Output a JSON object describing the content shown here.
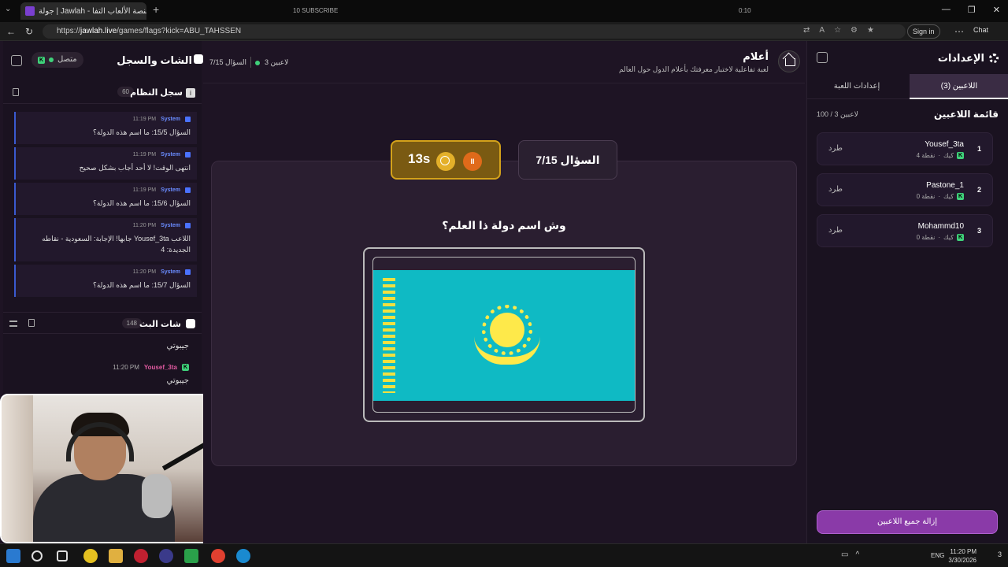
{
  "browser": {
    "tab_title": "جولة | Jawlah - منصة الألعاب التفا...",
    "url_prefix": "https://",
    "url_host": "jawlah.live",
    "url_path": "/games/flags?kick=ABU_TAHSSEN",
    "sign_in": "Sign in",
    "chat": "Chat",
    "overlay_subscribe": "10 SUBSCRIBE",
    "overlay_time": "0:10"
  },
  "left_panel": {
    "title": "الشات والسجل",
    "status": "متصل",
    "system_log": {
      "title": "سجل النظام",
      "count": "60",
      "messages": [
        {
          "sender": "System",
          "time": "11:19 PM",
          "text": "السؤال 15/5: ما اسم هذه الدولة؟"
        },
        {
          "sender": "System",
          "time": "11:19 PM",
          "text": "انتهى الوقت! لا أحد أجاب بشكل صحيح"
        },
        {
          "sender": "System",
          "time": "11:19 PM",
          "text": "السؤال 15/6: ما اسم هذه الدولة؟"
        },
        {
          "sender": "System",
          "time": "11:20 PM",
          "text": "اللاعب Yousef_3ta جابها! الإجابة: السعودية - نقاطه الجديدة: 4"
        },
        {
          "sender": "System",
          "time": "11:20 PM",
          "text": "السؤال 15/7: ما اسم هذه الدولة؟"
        }
      ]
    },
    "live_chat": {
      "title": "شات البث",
      "count": "148",
      "msg1": "جيبوتي",
      "msg2_user": "Yousef_3ta",
      "msg2_time": "11:20 PM",
      "msg2_text": "جيبوتي"
    }
  },
  "center": {
    "question_small": "السؤال 7/15",
    "players_online": "3 لاعبين",
    "game_title": "أعلام",
    "game_desc": "لعبة تفاعلية لاختبار معرفتك بأعلام الدول حول العالم",
    "question_card": "السؤال 7/15",
    "timer": "13s",
    "pause": "II",
    "question_text": "وش اسم دولة ذا العلم؟"
  },
  "right_panel": {
    "title": "الإعدادات",
    "tab_players": "اللاعبين (3)",
    "tab_game_settings": "إعدادات اللعبة",
    "players_list_title": "قائمة اللاعبين",
    "players_count": "100 / 3 لاعبين",
    "kick_label": "طرد",
    "players": [
      {
        "rank": "1",
        "name": "Yousef_3ta",
        "points": "4 نقطة",
        "platform": "كيك"
      },
      {
        "rank": "2",
        "name": "Pastone_1",
        "points": "0 نقطة",
        "platform": "كيك"
      },
      {
        "rank": "3",
        "name": "Mohammd10",
        "points": "0 نقطة",
        "platform": "كيك"
      }
    ],
    "remove_all": "إزالة جميع اللاعبين"
  },
  "taskbar": {
    "time": "11:20 PM",
    "date": "3/30/2026",
    "lang": "ENG",
    "notifications": "3"
  },
  "colors": {
    "accent_purple": "#8a3aa8",
    "timer_gold": "#d4a21a",
    "kick_green": "#3fd07a",
    "flag_blue": "#0fbac4",
    "flag_yellow": "#fee94a"
  }
}
